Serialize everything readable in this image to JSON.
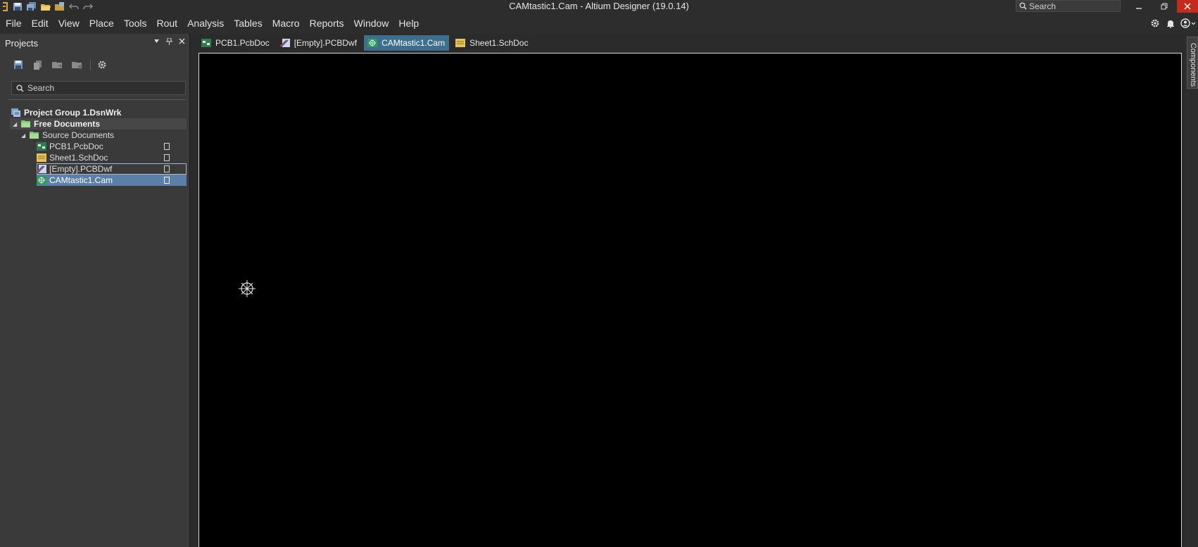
{
  "title_bar": {
    "title": "CAMtastic1.Cam - Altium Designer (19.0.14)",
    "search_placeholder": "Search",
    "colors": {
      "close_button": "#c42b1c",
      "background": "#2d2d2d"
    }
  },
  "menu": [
    "File",
    "Edit",
    "View",
    "Place",
    "Tools",
    "Rout",
    "Analysis",
    "Tables",
    "Macro",
    "Reports",
    "Window",
    "Help"
  ],
  "projects_panel": {
    "title": "Projects",
    "search_placeholder": "Search",
    "tree": {
      "group": "Project Group 1.DsnWrk",
      "folder": "Free Documents",
      "subfolder": "Source Documents",
      "items": [
        "PCB1.PcbDoc",
        "Sheet1.SchDoc",
        "[Empty].PCBDwf",
        "CAMtastic1.Cam"
      ],
      "selected": "CAMtastic1.Cam"
    }
  },
  "document_tabs": {
    "items": [
      "PCB1.PcbDoc",
      "[Empty].PCBDwf",
      "CAMtastic1.Cam",
      "Sheet1.SchDoc"
    ],
    "active": "CAMtastic1.Cam",
    "colors": {
      "active": "#3e6e8e"
    }
  },
  "right_panel_tab": "Components",
  "canvas": {
    "background": "#000000"
  },
  "icons": [
    "save-icon",
    "save-all-icon",
    "open-icon",
    "open-project-icon",
    "undo-icon",
    "redo-icon",
    "settings-icon",
    "notifications-icon",
    "user-icon",
    "search-icon",
    "pin-icon",
    "close-icon",
    "menu-arrow-icon",
    "crosshair-icon"
  ]
}
